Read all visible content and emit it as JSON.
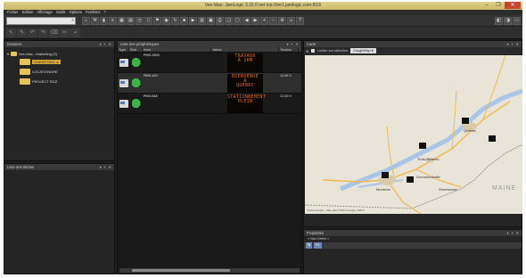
{
  "window": {
    "title": "Vee-Max: JamLogic 3.16.0 net tcp://lve1.jamlogic.com:810/"
  },
  "menu": [
    "Fichier",
    "Edition",
    "Affichage",
    "Outils",
    "Options",
    "Fenêtres",
    "?"
  ],
  "toolbar": {
    "search_value": ""
  },
  "explorer": {
    "title": "Dossiers",
    "root": "Vee-Max - Marketing (3)",
    "folders": [
      "CLIENT DOC a",
      "LOCATIONDRE",
      "PROJECT RGZ"
    ]
  },
  "taches": {
    "title": "Liste des tâches"
  },
  "signs": {
    "title": "Liste des périphériques",
    "columns": [
      "Type",
      "État",
      "Nom",
      "Valeur",
      "Tension"
    ],
    "rows": [
      {
        "name": "PMV-1503",
        "message": [
          "TRAVAUX",
          "À 1KM",
          ""
        ],
        "voltage": ""
      },
      {
        "name": "PMV-120",
        "message": [
          "BIENVENUE",
          "À",
          "QUÉBEC"
        ],
        "voltage": "12,65 V"
      },
      {
        "name": "PMV-548",
        "message": [
          "STATIONNEMENT",
          "PLEIN",
          ""
        ],
        "voltage": "12,65 V"
      }
    ]
  },
  "map_panel": {
    "title": "Carte",
    "checkbox_label": "Limiter sur sélection",
    "provider": "GoogleMap",
    "attribution": "©2014 Google · Map data ©2014 Google, INEGI",
    "labels": {
      "quebec": "Québec",
      "montreal": "Montréal",
      "trois_rivieres": "Trois-Rivières",
      "sherbrooke": "Sherbrooke",
      "drummondville": "Drummondville",
      "maine": "MAINE"
    }
  },
  "properties": {
    "title": "Propriétés",
    "row1": "« Non Défini »",
    "tab": "F1"
  }
}
